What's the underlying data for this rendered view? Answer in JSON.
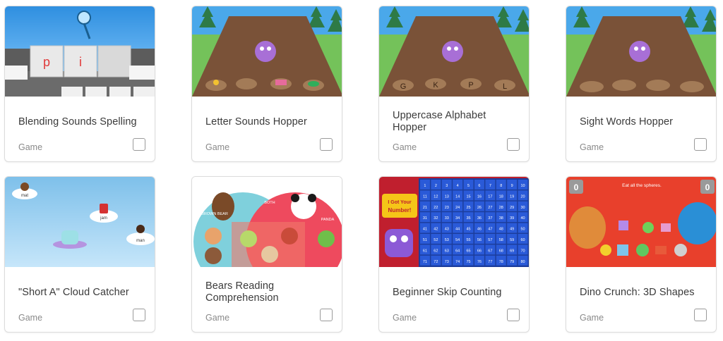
{
  "cards": [
    {
      "title": "Blending Sounds Spelling",
      "type": "Game",
      "thumbnail": "blending-sounds-spelling-image",
      "tiles": [
        "p",
        "i"
      ]
    },
    {
      "title": "Letter Sounds Hopper",
      "type": "Game",
      "thumbnail": "letter-sounds-hopper-image"
    },
    {
      "title": "Uppercase Alphabet Hopper",
      "type": "Game",
      "thumbnail": "uppercase-alphabet-hopper-image",
      "stones": [
        "G",
        "K",
        "P",
        "L"
      ]
    },
    {
      "title": "Sight Words Hopper",
      "type": "Game",
      "thumbnail": "sight-words-hopper-image"
    },
    {
      "title": "\"Short A\" Cloud Catcher",
      "type": "Game",
      "thumbnail": "short-a-cloud-catcher-image",
      "clouds": [
        "mat",
        "jam",
        "man"
      ]
    },
    {
      "title": "Bears Reading Comprehension",
      "type": "Game",
      "thumbnail": "bears-reading-comprehension-image",
      "labels": [
        "BROWN BEAR",
        "BOTH",
        "PANDA"
      ]
    },
    {
      "title": "Beginner Skip Counting",
      "type": "Game",
      "thumbnail": "beginner-skip-counting-image",
      "banner": [
        "I Got Your",
        "Number!"
      ]
    },
    {
      "title": "Dino Crunch: 3D Shapes",
      "type": "Game",
      "thumbnail": "dino-crunch-3d-shapes-image",
      "instruction": "Eat all the spheres.",
      "scores": [
        "0",
        "0"
      ]
    }
  ],
  "colors": {
    "sky": "#3a9fe8",
    "grass": "#7cc35b",
    "dirt": "#7a5238",
    "monster": "#a86fd6",
    "grid": "#2454c7",
    "dino_bg": "#e8402c"
  }
}
